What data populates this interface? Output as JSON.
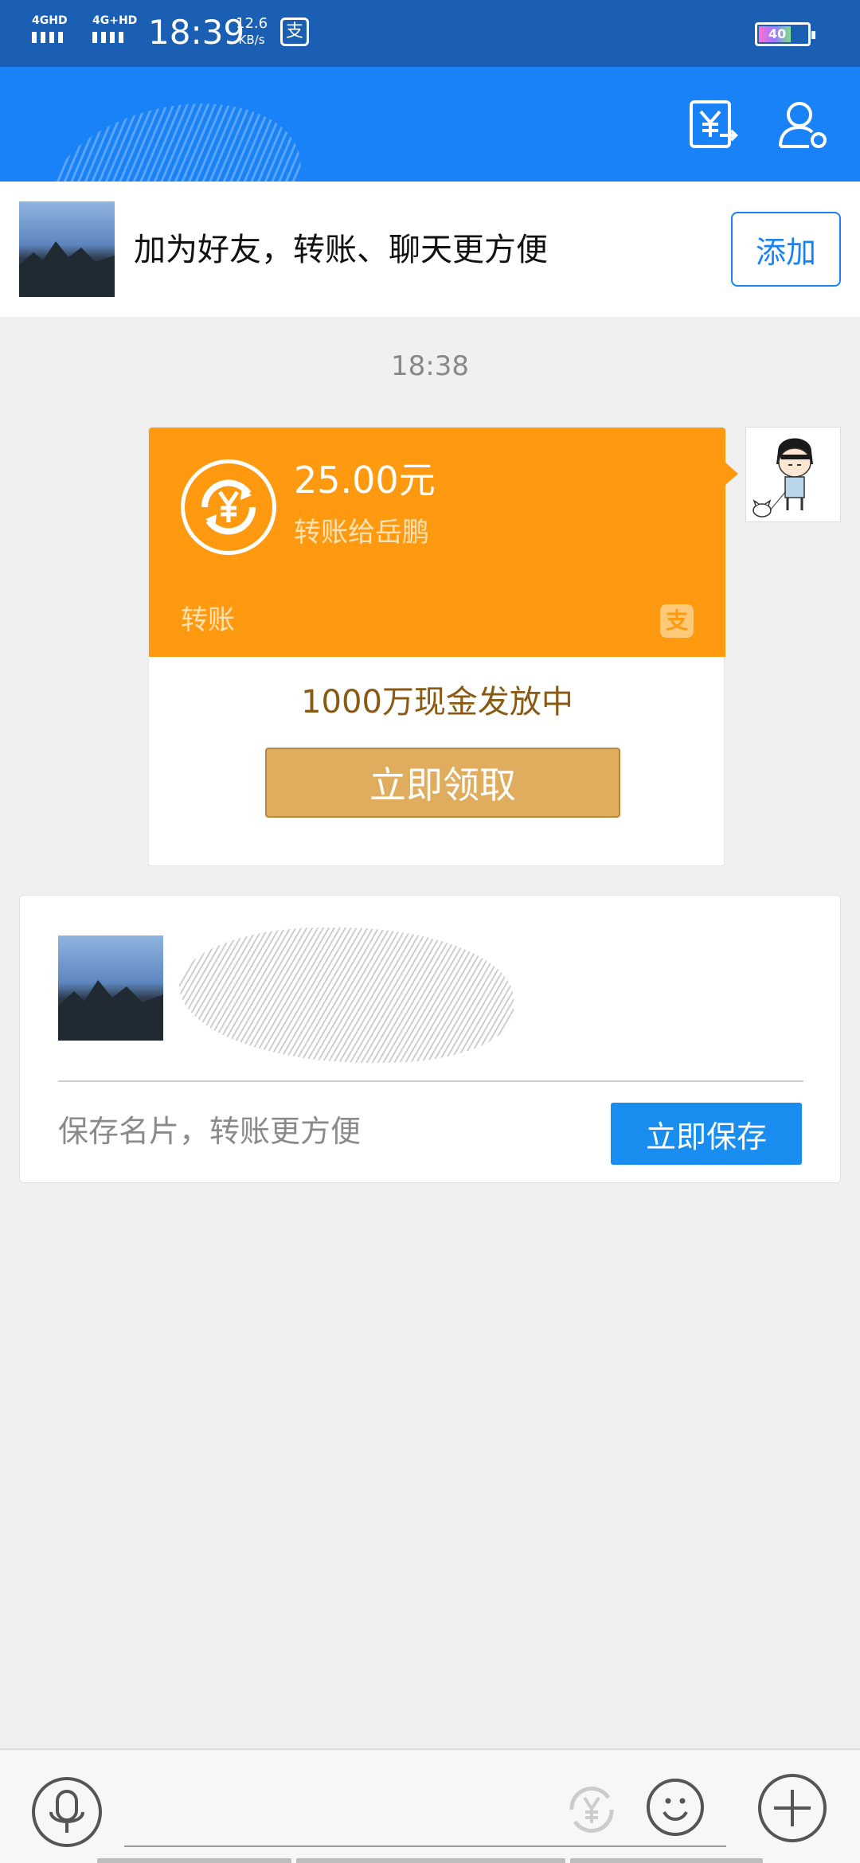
{
  "status_bar": {
    "network_1": "4GHD",
    "network_2": "4G+HD",
    "time": "18:39",
    "speed_value": "12.6",
    "speed_unit": "KB/s",
    "pay_icon_glyph": "支",
    "battery_level": "40",
    "background": "#1a5fb4"
  },
  "header": {
    "background": "#1a82f7",
    "transfer_icon": "yen-transfer-icon",
    "profile_icon": "user-settings-icon"
  },
  "friend_bar": {
    "text": "加为好友，转账、聊天更方便",
    "add_button": "添加"
  },
  "chat": {
    "timestamp": "18:38",
    "transfer_card": {
      "amount": "25.00元",
      "recipient": "转账给岳鹏",
      "type_label": "转账",
      "alipay_glyph": "支",
      "promo_text": "1000万现金发放中",
      "claim_button": "立即领取",
      "accent": "#ff9a10"
    }
  },
  "contact_card": {
    "hint": "保存名片，转账更方便",
    "save_button": "立即保存"
  },
  "bottom_bar": {
    "voice_icon": "microphone-icon",
    "yen_icon": "yen-circle-icon",
    "emoji_icon": "smiley-icon",
    "plus_icon": "plus-icon"
  }
}
